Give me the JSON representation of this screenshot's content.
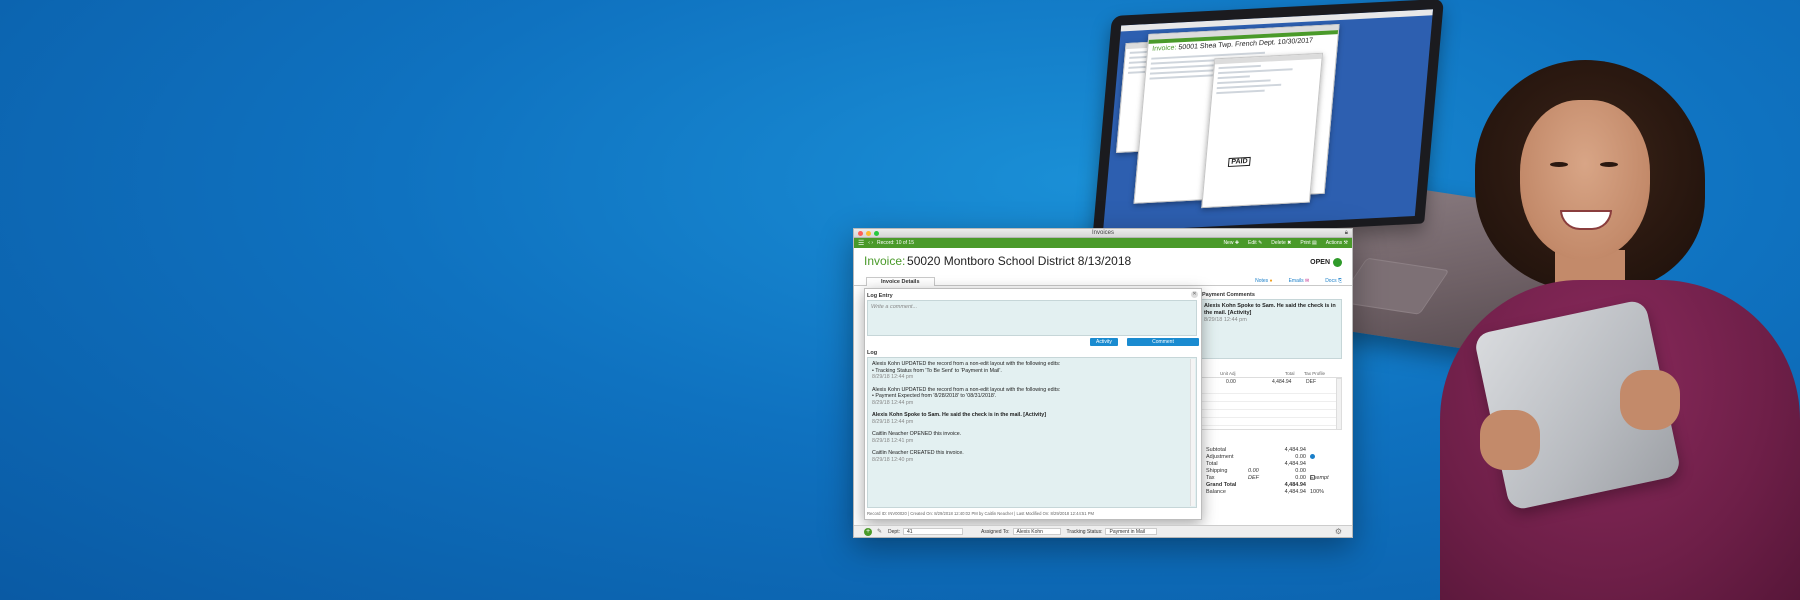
{
  "laptop_screen": {
    "window_title_prefix": "Invoice:",
    "window_title": "50001 Shea Twp. French Dept. 10/30/2017",
    "stamp": "PAID"
  },
  "window": {
    "title": "Invoices"
  },
  "toolbar": {
    "record": "Record: 10 of 15",
    "buttons": [
      "New",
      "Edit",
      "Delete",
      "Print",
      "Actions"
    ]
  },
  "invoice": {
    "label": "Invoice:",
    "title": "50020 Montboro School District  8/13/2018",
    "status": "OPEN",
    "status_color": "#2f9a2a"
  },
  "tabs": {
    "active": "Invoice Details",
    "links": [
      "Notes",
      "Emails",
      "Docs"
    ]
  },
  "payment_comments": {
    "label": "Payment Comments",
    "text": "Alexis Kohn Spoke to Sam. He said the check is in the mail. [Activity]",
    "meta": "8/29/18  12:44 pm"
  },
  "line_items": {
    "headers": [
      "Unit Adj",
      "Total",
      "Tax Profile"
    ],
    "row": {
      "unit_adj": "0.00",
      "total": "4,484.94",
      "tax_profile": "DEF"
    }
  },
  "totals": {
    "subtotal_label": "Subtotal",
    "subtotal": "4,484.94",
    "adjustment_label": "Adjustment",
    "adjustment": "0.00",
    "total_label": "Total",
    "total": "4,484.94",
    "shipping_label": "Shipping",
    "shipping_rate": "0.00",
    "shipping": "0.00",
    "tax_label": "Tax",
    "tax_code": "DEF",
    "tax": "0.00",
    "exempt_label": "Exempt",
    "grand_total_label": "Grand Total",
    "grand_total": "4,484.94",
    "balance_label": "Balance",
    "balance": "4,484.94",
    "balance_pct": "100%"
  },
  "log_popover": {
    "entry_label": "Log Entry",
    "placeholder": "Write a comment...",
    "activity_button": "Activity",
    "comment_button": "Comment",
    "log_label": "Log",
    "entries": [
      {
        "line1": "Alexis Kohn UPDATED the record from a non-edit layout with the following edits:",
        "line2": "• Tracking Status from 'To Be Sent' to 'Payment in Mail'.",
        "ts": "8/29/18  12:44 pm"
      },
      {
        "line1": "Alexis Kohn UPDATED the record from a non-edit layout with the following edits:",
        "line2": "• Payment Expected from '8/28/2018' to '08/31/2018'.",
        "ts": "8/29/18  12:44 pm"
      },
      {
        "line1": "Alexis Kohn Spoke to Sam. He said the check is in the mail. [Activity]",
        "line2": "",
        "ts": "8/29/18  12:44 pm"
      },
      {
        "line1": "Caitlin Neacher OPENED this invoice.",
        "line2": "",
        "ts": "8/29/18  12:41 pm"
      },
      {
        "line1": "Caitlin Neacher CREATED this invoice.",
        "line2": "",
        "ts": "8/29/18  12:40 pm"
      }
    ],
    "footer": "Record ID: INV00020  |  Created On: 8/29/2018 12:40:02 PM by Caitlin Neacher  |  Last Modified On: 8/29/2018 12:44:51 PM"
  },
  "statusbar": {
    "dept_label": "Dept:",
    "dept": "41",
    "assigned_label": "Assigned To:",
    "assigned": "Alexis Kohn",
    "tracking_label": "Tracking Status:",
    "tracking": "Payment in Mail"
  }
}
